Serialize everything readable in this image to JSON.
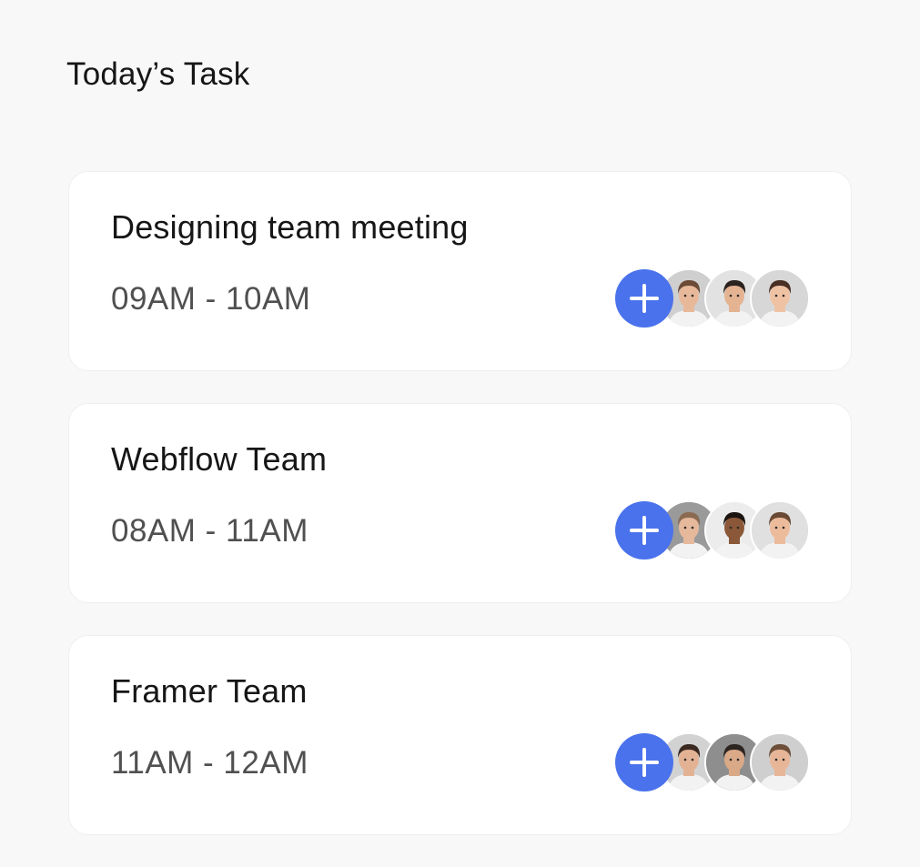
{
  "page": {
    "title": "Today’s Task"
  },
  "tasks": [
    {
      "name": "Designing team meeting",
      "time": "09AM - 10AM",
      "add_icon": "plus-icon",
      "avatars": [
        {
          "bg": "#cfcfcf",
          "skin": "#e8b89a",
          "hair": "#6b4a36"
        },
        {
          "bg": "#e2e2e2",
          "skin": "#e4b392",
          "hair": "#2b2320"
        },
        {
          "bg": "#d7d7d7",
          "skin": "#efc2a4",
          "hair": "#4a3024"
        }
      ]
    },
    {
      "name": "Webflow Team",
      "time": "08AM - 11AM",
      "add_icon": "plus-icon",
      "avatars": [
        {
          "bg": "#9a9a9a",
          "skin": "#e6b89c",
          "hair": "#8a6a50"
        },
        {
          "bg": "#ececec",
          "skin": "#8a5838",
          "hair": "#1b1410"
        },
        {
          "bg": "#e0e0e0",
          "skin": "#ecbb9c",
          "hair": "#6a4a34"
        }
      ]
    },
    {
      "name": "Framer Team",
      "time": "11AM - 12AM",
      "add_icon": "plus-icon",
      "avatars": [
        {
          "bg": "#d2d2d2",
          "skin": "#e3b294",
          "hair": "#3a2a22"
        },
        {
          "bg": "#8e8e8e",
          "skin": "#d9a988",
          "hair": "#2c2420"
        },
        {
          "bg": "#cfcfcf",
          "skin": "#e7b698",
          "hair": "#6e4f3a"
        }
      ]
    }
  ],
  "colors": {
    "accent": "#4a72ec",
    "card": "#ffffff",
    "background": "#f8f8f8"
  }
}
